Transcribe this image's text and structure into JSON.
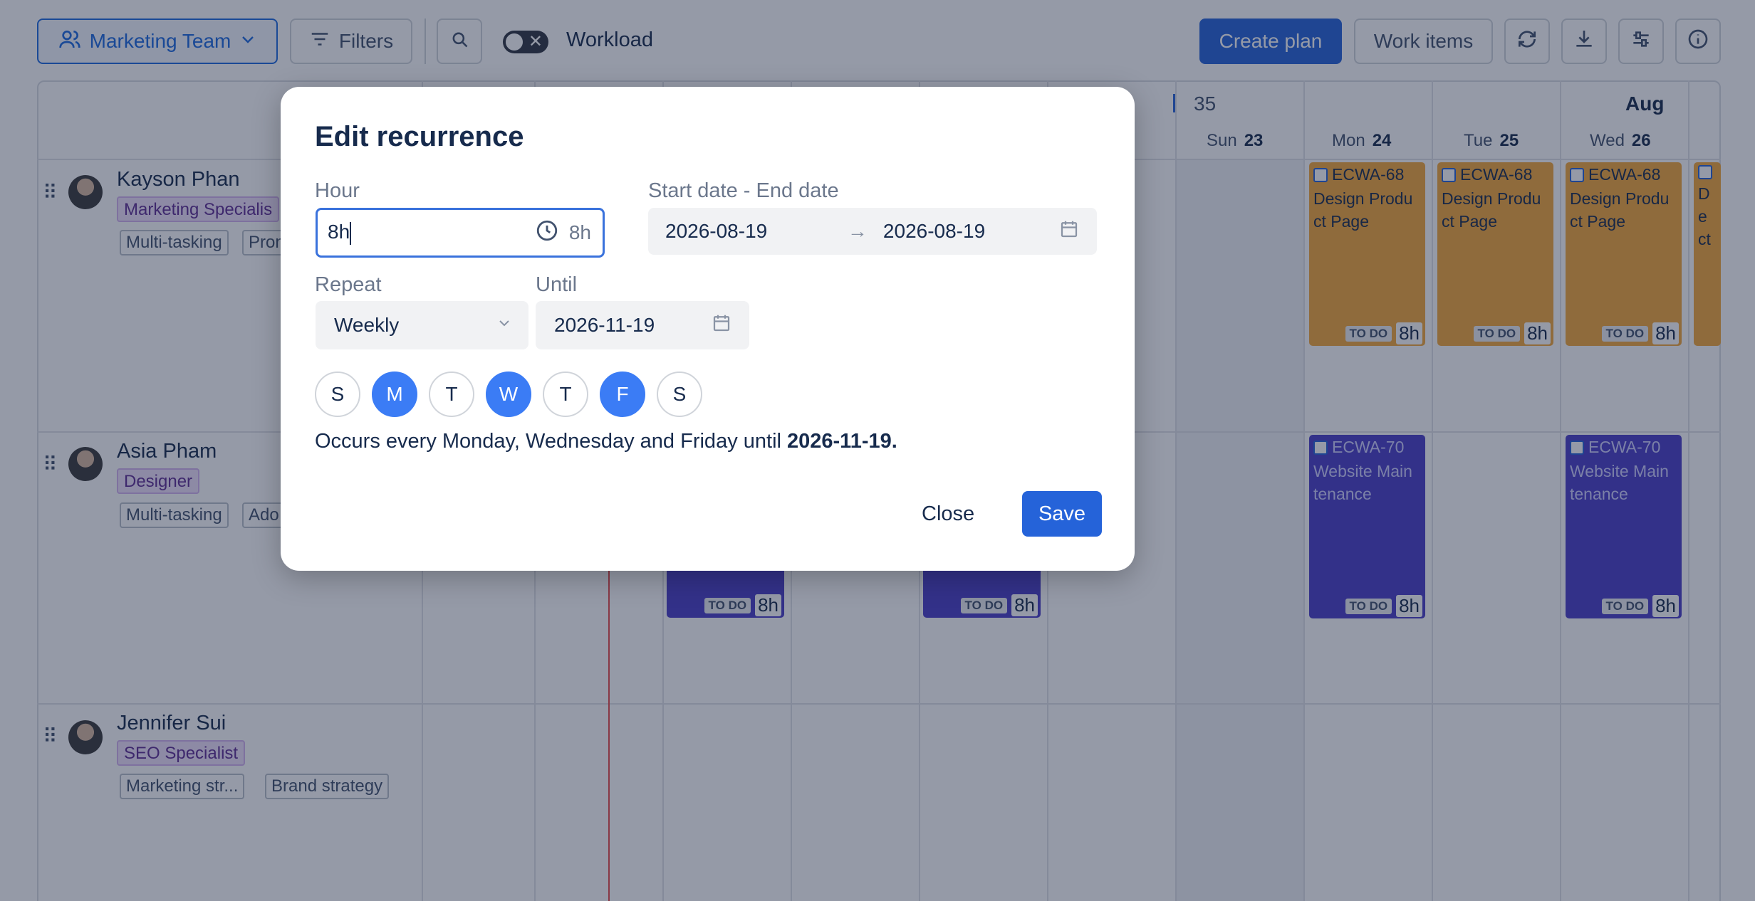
{
  "toolbar": {
    "team_label": "Marketing Team",
    "filters_label": "Filters",
    "workload_label": "Workload",
    "create_plan_label": "Create plan",
    "work_items_label": "Work items",
    "icons": [
      "users-icon",
      "filter-icon",
      "search-icon",
      "refresh-icon",
      "download-icon",
      "settings-sliders-icon",
      "info-icon"
    ]
  },
  "calendar": {
    "week_number": "35",
    "month": "Aug",
    "days": [
      {
        "name": "Sun",
        "date": "23"
      },
      {
        "name": "Mon",
        "date": "24"
      },
      {
        "name": "Tue",
        "date": "25"
      },
      {
        "name": "Wed",
        "date": "26"
      }
    ]
  },
  "people": [
    {
      "name": "Kayson Phan",
      "role": "Marketing Specialis",
      "skills": [
        "Multi-tasking",
        "Pron"
      ]
    },
    {
      "name": "Asia Pham",
      "role": "Designer",
      "skills": [
        "Multi-tasking",
        "Ado"
      ]
    },
    {
      "name": "Jennifer Sui",
      "role": "SEO Specialist",
      "skills": [
        "Marketing str...",
        "Brand strategy"
      ]
    }
  ],
  "tasks": {
    "design": {
      "key": "ECWA-68",
      "title": "Design Produ ct Page",
      "status": "TO DO",
      "hours": "8h",
      "partial_title": "De ct"
    },
    "website": {
      "key": "ECWA-70",
      "title": "Website Main tenance",
      "status": "TO DO",
      "hours": "8h"
    }
  },
  "modal": {
    "title": "Edit recurrence",
    "hour_label": "Hour",
    "hour_value": "8h",
    "hour_suffix": "8h",
    "range_label": "Start date - End date",
    "start_date": "2026-08-19",
    "end_date": "2026-08-19",
    "range_arrow": "→",
    "repeat_label": "Repeat",
    "repeat_value": "Weekly",
    "until_label": "Until",
    "until_value": "2026-11-19",
    "weekdays": [
      {
        "letter": "S",
        "selected": false
      },
      {
        "letter": "M",
        "selected": true
      },
      {
        "letter": "T",
        "selected": false
      },
      {
        "letter": "W",
        "selected": true
      },
      {
        "letter": "T",
        "selected": false
      },
      {
        "letter": "F",
        "selected": true
      },
      {
        "letter": "S",
        "selected": false
      }
    ],
    "summary_prefix": "Occurs every Monday, Wednesday and Friday until ",
    "summary_date": "2026-11-19.",
    "close_label": "Close",
    "save_label": "Save"
  },
  "colors": {
    "accent": "#2563d9",
    "selected_day": "#3b7cf5",
    "task_orange": "#f4a83a",
    "task_purple": "#4a3ec8",
    "today_line": "#e84a4a"
  }
}
